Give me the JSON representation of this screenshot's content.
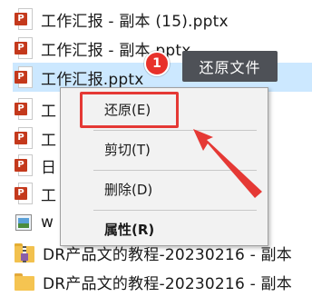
{
  "files": [
    {
      "name": "工作汇报 - 副本 (15).pptx",
      "icon": "powerpoint-icon"
    },
    {
      "name": "工作汇报 - 副本.pptx",
      "icon": "powerpoint-icon"
    },
    {
      "name": "工作汇报.pptx",
      "icon": "powerpoint-icon",
      "selected": true
    },
    {
      "name": "工",
      "icon": "powerpoint-icon"
    },
    {
      "name": "工",
      "icon": "powerpoint-icon"
    },
    {
      "name": "日",
      "icon": "powerpoint-icon"
    },
    {
      "name": "工",
      "icon": "powerpoint-icon"
    },
    {
      "name": "w",
      "icon": "image-icon"
    },
    {
      "name": "DR产品文的教程-20230216 - 副本",
      "icon": "zip-folder-icon"
    },
    {
      "name": "DR产品文的教程-20230216 - 副本",
      "icon": "folder-icon"
    }
  ],
  "context_menu": {
    "restore": "还原(E)",
    "cut": "剪切(T)",
    "delete": "删除(D)",
    "properties": "属性(R)"
  },
  "callout": {
    "step_number": "1",
    "tooltip": "还原文件"
  },
  "colors": {
    "selection": "#cce8ff",
    "annotation_red": "#e53935",
    "tooltip_bg": "#4e5157",
    "powerpoint": "#c4391c"
  },
  "ppt_glyph": "P"
}
